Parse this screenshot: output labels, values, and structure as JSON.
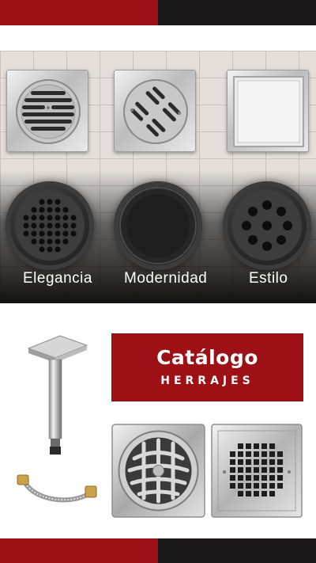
{
  "hero": {
    "words": [
      "Elegancia",
      "Modernidad",
      "Estilo"
    ]
  },
  "catalog": {
    "title": "Catálogo",
    "subtitle": "HERRAJES"
  },
  "colors": {
    "brand_red": "#9c1016",
    "brand_black": "#1a1818"
  },
  "icons": {
    "top_bar": "two-tone-color-bar",
    "products": [
      "shower-arm-icon",
      "flex-hose-icon",
      "round-grate-drain-icon",
      "square-grid-drain-icon"
    ]
  }
}
